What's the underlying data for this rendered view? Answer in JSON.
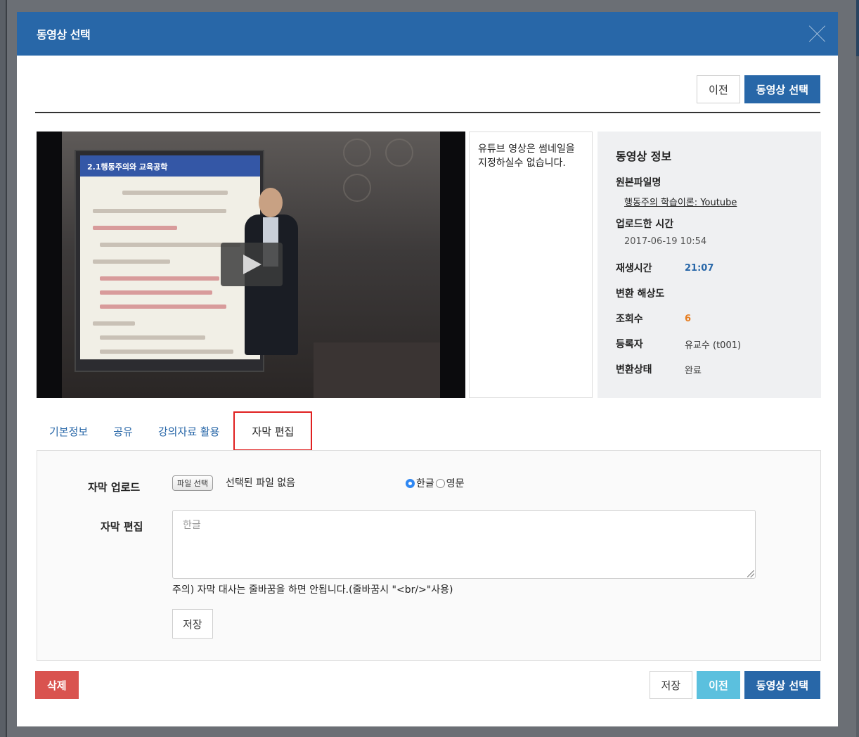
{
  "modal": {
    "title": "동영상 선택"
  },
  "top_actions": {
    "prev_label": "이전",
    "select_label": "동영상 선택"
  },
  "notice": "유튜브 영상은 썸네일을 지정하실수 없습니다.",
  "video": {
    "slide_title": "2.1행동주의와 교육공학"
  },
  "info": {
    "title": "동영상 정보",
    "original_file_label": "원본파일명",
    "original_file_value": "행동주의 학습이론: Youtube",
    "upload_time_label": "업로드한 시간",
    "upload_time_value": "2017-06-19 10:54",
    "duration_label": "재생시간",
    "duration_value": "21:07",
    "resolution_label": "변환 해상도",
    "views_label": "조회수",
    "views_value": "6",
    "registrant_label": "등록자",
    "registrant_value": "유교수 (t001)",
    "conversion_label": "변환상태",
    "conversion_value": "완료"
  },
  "tabs": [
    {
      "label": "기본정보"
    },
    {
      "label": "공유"
    },
    {
      "label": "강의자료 활용"
    },
    {
      "label": "자막 편집"
    }
  ],
  "subtitle_form": {
    "upload_label": "자막 업로드",
    "file_button": "파일 선택",
    "file_status": "선택된 파일 없음",
    "radio_korean": "한글",
    "radio_english": "영문",
    "edit_label": "자막 편집",
    "textarea_placeholder": "한글",
    "warning": "주의) 자막 대사는 줄바꿈을 하면 안됩니다.(줄바꿈시 \"<br/>\"사용)",
    "save_label": "저장"
  },
  "bottom_actions": {
    "delete_label": "삭제",
    "save_label": "저장",
    "prev_label": "이전",
    "select_label": "동영상 선택"
  },
  "colors": {
    "header_blue": "#2867a8",
    "info_cyan": "#5bc0de",
    "danger_red": "#d9534f",
    "active_tab_border": "#e02020"
  }
}
